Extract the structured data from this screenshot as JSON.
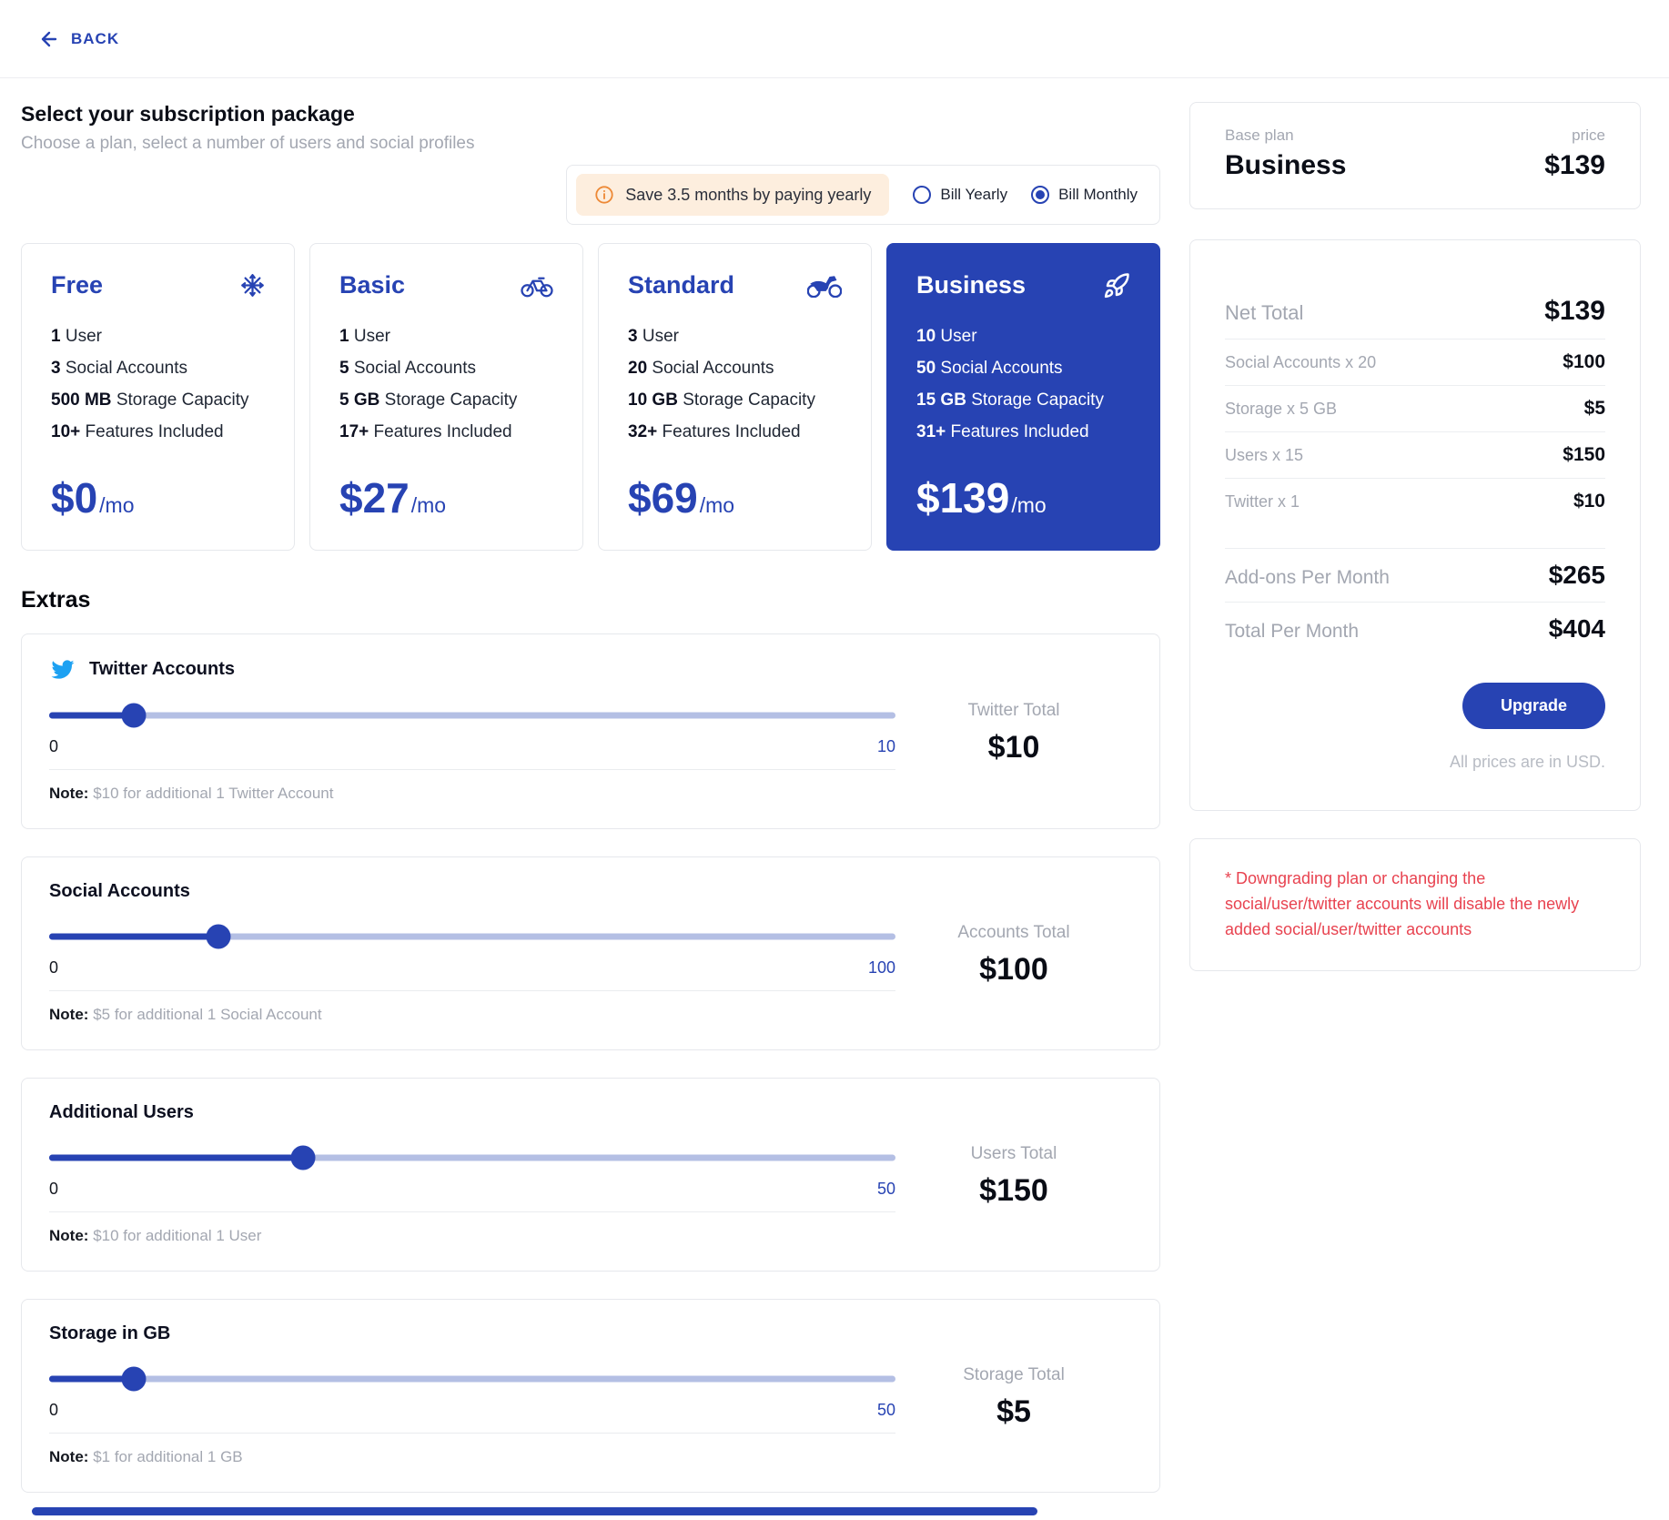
{
  "header": {
    "back_label": "BACK"
  },
  "page": {
    "title": "Select your subscription package",
    "subtitle": "Choose a plan, select a number of users and social profiles"
  },
  "billing": {
    "banner": "Save 3.5 months by paying yearly",
    "options": [
      {
        "label": "Bill Yearly",
        "selected": false
      },
      {
        "label": "Bill Monthly",
        "selected": true
      }
    ]
  },
  "plans": [
    {
      "name": "Free",
      "icon": "snowflake-icon",
      "selected": false,
      "features": [
        {
          "bold": "1",
          "text": "User"
        },
        {
          "bold": "3",
          "text": "Social Accounts"
        },
        {
          "bold": "500 MB",
          "text": "Storage Capacity"
        },
        {
          "bold": "10+",
          "text": "Features Included"
        }
      ],
      "price": "$0",
      "period": "/mo"
    },
    {
      "name": "Basic",
      "icon": "bicycle-icon",
      "selected": false,
      "features": [
        {
          "bold": "1",
          "text": "User"
        },
        {
          "bold": "5",
          "text": "Social Accounts"
        },
        {
          "bold": "5 GB",
          "text": "Storage Capacity"
        },
        {
          "bold": "17+",
          "text": "Features Included"
        }
      ],
      "price": "$27",
      "period": "/mo"
    },
    {
      "name": "Standard",
      "icon": "motorcycle-icon",
      "selected": false,
      "features": [
        {
          "bold": "3",
          "text": "User"
        },
        {
          "bold": "20",
          "text": "Social Accounts"
        },
        {
          "bold": "10 GB",
          "text": "Storage Capacity"
        },
        {
          "bold": "32+",
          "text": "Features Included"
        }
      ],
      "price": "$69",
      "period": "/mo"
    },
    {
      "name": "Business",
      "icon": "rocket-icon",
      "selected": true,
      "features": [
        {
          "bold": "10",
          "text": "User"
        },
        {
          "bold": "50",
          "text": "Social Accounts"
        },
        {
          "bold": "15 GB",
          "text": "Storage Capacity"
        },
        {
          "bold": "31+",
          "text": "Features Included"
        }
      ],
      "price": "$139",
      "period": "/mo"
    }
  ],
  "extras": {
    "heading": "Extras",
    "note_label": "Note:",
    "items": [
      {
        "label": "Twitter Accounts",
        "min": "0",
        "max": "10",
        "value": 1,
        "max_num": 10,
        "total_label": "Twitter Total",
        "total": "$10",
        "note": "$10 for additional 1 Twitter Account"
      },
      {
        "label": "Social Accounts",
        "min": "0",
        "max": "100",
        "value": 20,
        "max_num": 100,
        "total_label": "Accounts Total",
        "total": "$100",
        "note": "$5 for additional 1 Social Account"
      },
      {
        "label": "Additional Users",
        "min": "0",
        "max": "50",
        "value": 15,
        "max_num": 50,
        "total_label": "Users Total",
        "total": "$150",
        "note": "$10 for additional 1 User"
      },
      {
        "label": "Storage in GB",
        "min": "0",
        "max": "50",
        "value": 5,
        "max_num": 50,
        "total_label": "Storage Total",
        "total": "$5",
        "note": "$1 for additional 1 GB"
      }
    ]
  },
  "summary": {
    "base_plan_label": "Base plan",
    "base_plan_name": "Business",
    "price_label": "price",
    "base_price": "$139",
    "net_total_label": "Net Total",
    "net_total": "$139",
    "rows": [
      {
        "label": "Social Accounts x 20",
        "value": "$100"
      },
      {
        "label": "Storage x 5 GB",
        "value": "$5"
      },
      {
        "label": "Users x 15",
        "value": "$150"
      },
      {
        "label": "Twitter x 1",
        "value": "$10"
      }
    ],
    "addons_label": "Add-ons Per Month",
    "addons_total": "$265",
    "total_label": "Total Per Month",
    "total": "$404",
    "upgrade_label": "Upgrade",
    "currency_note": "All prices are in USD."
  },
  "warning": {
    "text": "* Downgrading plan or changing the social/user/twitter accounts will disable the newly added social/user/twitter accounts"
  },
  "colors": {
    "primary": "#2743b3",
    "slider_track": "#b4bfe4",
    "twitter": "#1da1f2",
    "banner_bg": "#fdeede",
    "banner_icon": "#ed8936",
    "warning": "#e84350",
    "text_dark": "#10131c",
    "text_gray": "#a3a7b1"
  }
}
